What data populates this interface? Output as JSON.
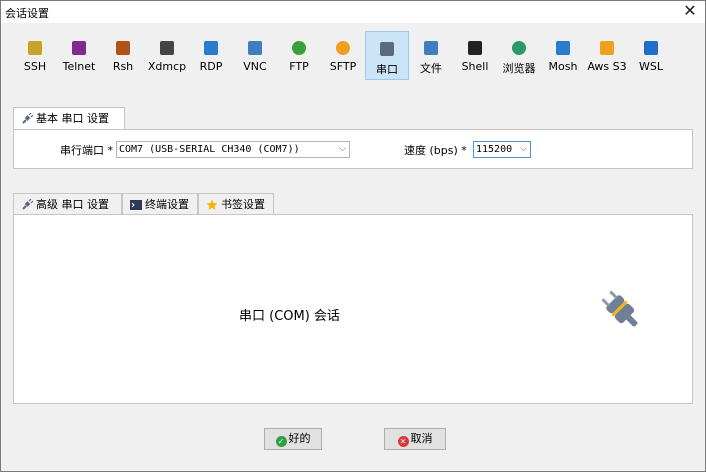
{
  "window": {
    "title": "会话设置",
    "close_glyph": "✕"
  },
  "toolbar": {
    "selected_index": 10,
    "items": [
      {
        "label": "SSH",
        "icon": "ssh-key-icon",
        "color": "#caa22a"
      },
      {
        "label": "Telnet",
        "icon": "telnet-monitor-icon",
        "color": "#7d2c8a"
      },
      {
        "label": "Rsh",
        "icon": "rsh-icon",
        "color": "#b2521b"
      },
      {
        "label": "Xdmcp",
        "icon": "xdmcp-x-icon",
        "color": "#444444"
      },
      {
        "label": "RDP",
        "icon": "rdp-monitor-icon",
        "color": "#2b7bd0"
      },
      {
        "label": "VNC",
        "icon": "vnc-monitor-icon",
        "color": "#3d7fbf"
      },
      {
        "label": "FTP",
        "icon": "ftp-globe-icon",
        "color": "#3aa13a"
      },
      {
        "label": "SFTP",
        "icon": "sftp-globe-icon",
        "color": "#f0a020"
      },
      {
        "label": "串口",
        "icon": "serial-plug-icon",
        "color": "#5b6b7f"
      },
      {
        "label": "文件",
        "icon": "file-monitor-icon",
        "color": "#3d7fbf"
      },
      {
        "label": "Shell",
        "icon": "shell-terminal-icon",
        "color": "#222222"
      },
      {
        "label": "浏览器",
        "icon": "browser-globe-icon",
        "color": "#2a9a6a"
      },
      {
        "label": "Mosh",
        "icon": "mosh-satellite-icon",
        "color": "#2b7bd0"
      },
      {
        "label": "Aws S3",
        "icon": "aws-s3-icon",
        "color": "#f0a020"
      },
      {
        "label": "WSL",
        "icon": "wsl-windows-icon",
        "color": "#1f6fc9"
      }
    ]
  },
  "basic_tab": {
    "label": "基本 串口 设置"
  },
  "port": {
    "label": "串行端口 *",
    "value": "COM7  (USB-SERIAL CH340 (COM7))"
  },
  "speed": {
    "label": "速度 (bps) *",
    "value": "115200"
  },
  "advanced_tabs": [
    {
      "label": "高级 串口 设置"
    },
    {
      "label": "终端设置"
    },
    {
      "label": "书签设置"
    }
  ],
  "session": {
    "text": "串口 (COM) 会话"
  },
  "buttons": {
    "ok": "好的",
    "cancel": "取消",
    "ok_color": "#2ea043",
    "cancel_color": "#d9373a"
  },
  "arrow_glyph": "⌵"
}
